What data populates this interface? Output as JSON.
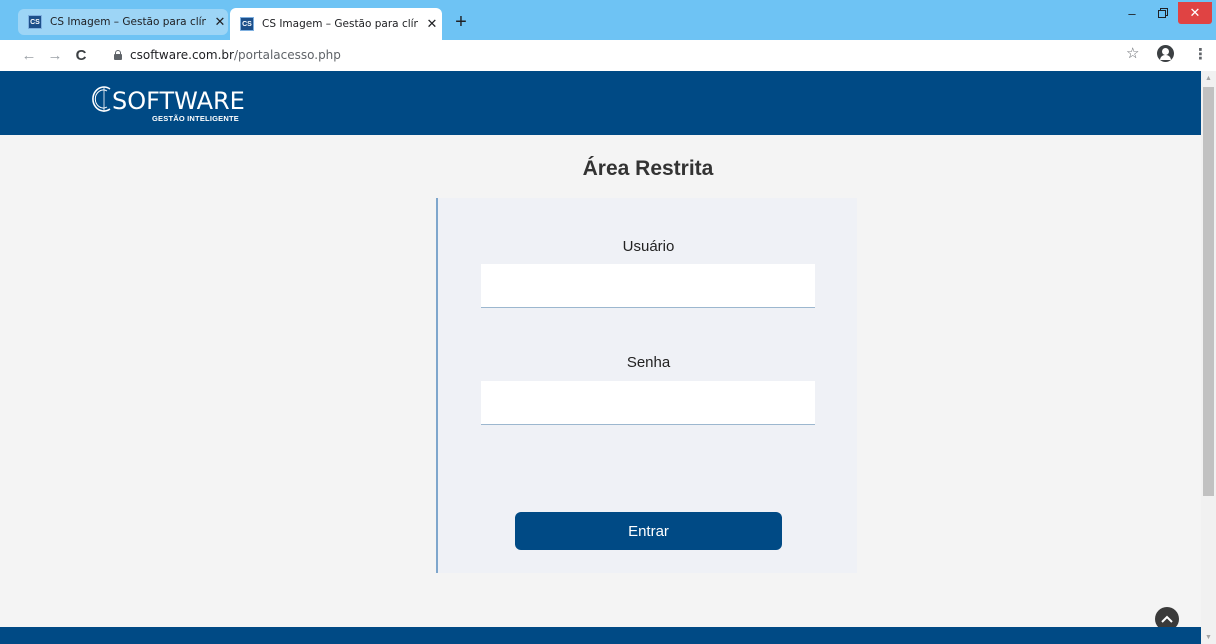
{
  "browser": {
    "tabs": [
      {
        "title": "CS Imagem – Gestão para clínicas",
        "favicon": "CS",
        "active": false
      },
      {
        "title": "CS Imagem – Gestão para clínicas",
        "favicon": "CS",
        "active": true
      }
    ],
    "new_tab_symbol": "+",
    "url_domain": "csoftware.com.br",
    "url_path": "/portalacesso.php",
    "icons": [
      "back-arrow-icon",
      "forward-arrow-icon",
      "reload-icon",
      "lock-icon",
      "star-icon",
      "account-icon",
      "menu-dots-icon"
    ]
  },
  "header": {
    "logo_letter": "C",
    "logo_word": "SOFTWARE",
    "logo_tagline": "GESTÃO INTELIGENTE"
  },
  "main": {
    "title": "Área Restrita",
    "username_label": "Usuário",
    "username_value": "",
    "password_label": "Senha",
    "password_value": "",
    "submit_label": "Entrar"
  },
  "colors": {
    "brand_blue": "#004a85",
    "tabstrip": "#6ec3f4",
    "panel_bg": "#eff1f6"
  }
}
